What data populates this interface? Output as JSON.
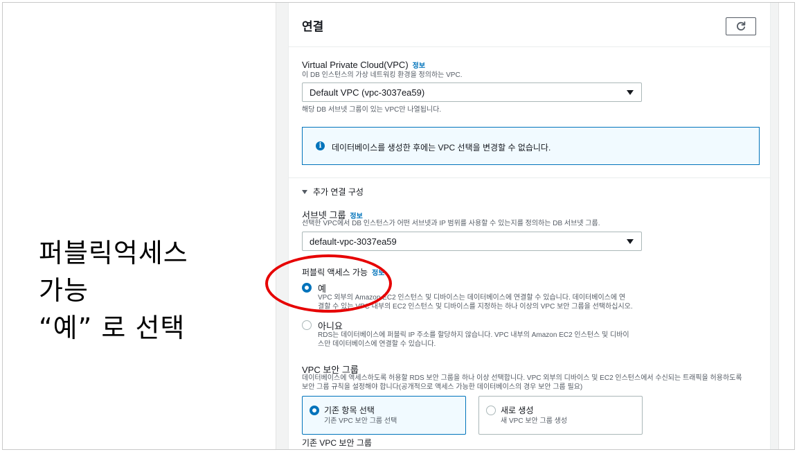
{
  "slide": {
    "caption_lines": [
      "퍼블릭억세스",
      "가능",
      "“예” 로 선택"
    ]
  },
  "section": {
    "title": "연결",
    "refresh_icon": "refresh-icon"
  },
  "vpc": {
    "label": "Virtual Private Cloud(VPC)",
    "info": "정보",
    "description": "이 DB 인스턴스의 가상 네트워킹 환경을 정의하는 VPC.",
    "selected": "Default VPC (vpc-3037ea59)",
    "hint": "해당 DB 서브넷 그룹이 있는 VPC만 나열됩니다."
  },
  "alert": {
    "icon": "info-icon",
    "text": "데이터베이스를 생성한 후에는 VPC 선택을 변경할 수 없습니다."
  },
  "additional": {
    "label": "추가 연결 구성"
  },
  "subnet": {
    "label": "서브넷 그룹",
    "info": "정보",
    "description": "선택한 VPC에서 DB 인스턴스가 어떤 서브넷과 IP 범위를 사용할 수 있는지를 정의하는 DB 서브넷 그룹.",
    "selected": "default-vpc-3037ea59"
  },
  "public_access": {
    "label": "퍼블릭 액세스 가능",
    "info": "정보",
    "yes_label": "예",
    "yes_desc_1": "VPC 외부의 Amazon EC2 인스턴스 및 디바이스는 데이터베이스에 연결할 수 있습니다. 데이터베이스에 연",
    "yes_desc_2": "결할 수 있는 VPC 내부의 EC2 인스턴스 및 디바이스를 지정하는 하나 이상의 VPC 보안 그룹을 선택하십시오.",
    "no_label": "아니요",
    "no_desc_1": "RDS는 데이터베이스에 퍼블릭 IP 주소를 할당하지 않습니다. VPC 내부의 Amazon EC2 인스턴스 및 디바이",
    "no_desc_2": "스만 데이터베이스에 연결할 수 있습니다."
  },
  "security_group": {
    "label": "VPC 보안 그룹",
    "desc_1": "데이터베이스에 액세스하도록 허용할 RDS 보안 그룹을 하나 이상 선택합니다. VPC 외부의 디바이스 및 EC2 인스턴스에서 수신되는 트래픽을 허용하도록",
    "desc_2": "보안 그룹 규칙을 설정해야 합니다(공개적으로 액세스 가능한 데이터베이스의 경우 보안 그룹 필요)",
    "existing_label": "기존 항목 선택",
    "existing_desc": "기존 VPC 보안 그룹 선택",
    "new_label": "새로 생성",
    "new_desc": "새 VPC 보안 그룹 생성",
    "existing_group_label": "기존 VPC 보안 그룹"
  },
  "colors": {
    "accent": "#0073bb",
    "annotation": "#e60000"
  }
}
